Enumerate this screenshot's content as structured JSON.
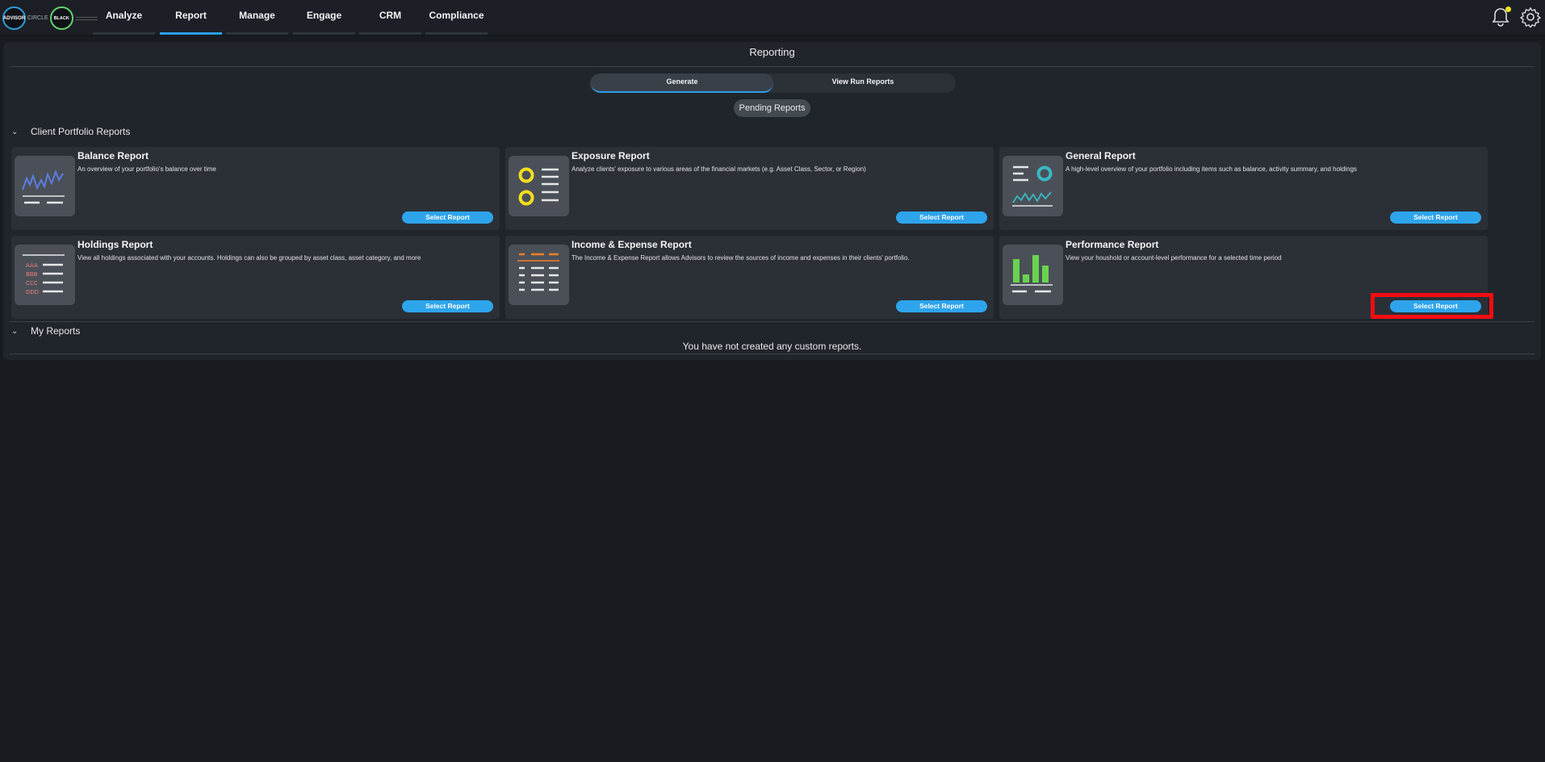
{
  "logo": {
    "brand_a": "ADVISOR",
    "brand_b_prefix": "CIRCLE",
    "brand_b": "BLACK"
  },
  "nav": {
    "tabs": [
      {
        "label": "Analyze",
        "active": false
      },
      {
        "label": "Report",
        "active": true
      },
      {
        "label": "Manage",
        "active": false
      },
      {
        "label": "Engage",
        "active": false
      },
      {
        "label": "CRM",
        "active": false
      },
      {
        "label": "Compliance",
        "active": false
      }
    ],
    "icons": [
      "bell-icon",
      "gear-icon"
    ]
  },
  "page": {
    "title": "Reporting",
    "segments": [
      {
        "label": "Generate",
        "active": true
      },
      {
        "label": "View Run Reports",
        "active": false
      }
    ],
    "pending_label": "Pending Reports"
  },
  "sections": {
    "client_portfolio": {
      "title": "Client Portfolio Reports",
      "cards": [
        {
          "title": "Balance Report",
          "description": "An overview of your portfolio's balance over time",
          "button": "Select Report"
        },
        {
          "title": "Exposure Report",
          "description": "Analyze clients' exposure to various areas of the financial markets (e.g. Asset Class, Sector, or Region)",
          "button": "Select Report"
        },
        {
          "title": "General Report",
          "description": "A high-level overview of your portfolio including items such as balance, activity summary, and holdings",
          "button": "Select Report"
        },
        {
          "title": "Holdings Report",
          "description": "View all holdings associated with your accounts. Holdings can also be grouped by asset class, asset category, and more",
          "button": "Select Report"
        },
        {
          "title": "Income & Expense Report",
          "description": "The Income & Expense Report allows Advisors to review the sources of income and expenses in their clients' portfolio.",
          "button": "Select Report"
        },
        {
          "title": "Performance Report",
          "description": "View your houshold or account-level performance for a selected time period",
          "button": "Select Report"
        }
      ]
    },
    "my_reports": {
      "title": "My Reports",
      "empty_message": "You have not created any custom reports."
    }
  },
  "colors": {
    "accent": "#2ea4ec",
    "highlight": "#f20d12",
    "notify": "#f4e41d"
  }
}
